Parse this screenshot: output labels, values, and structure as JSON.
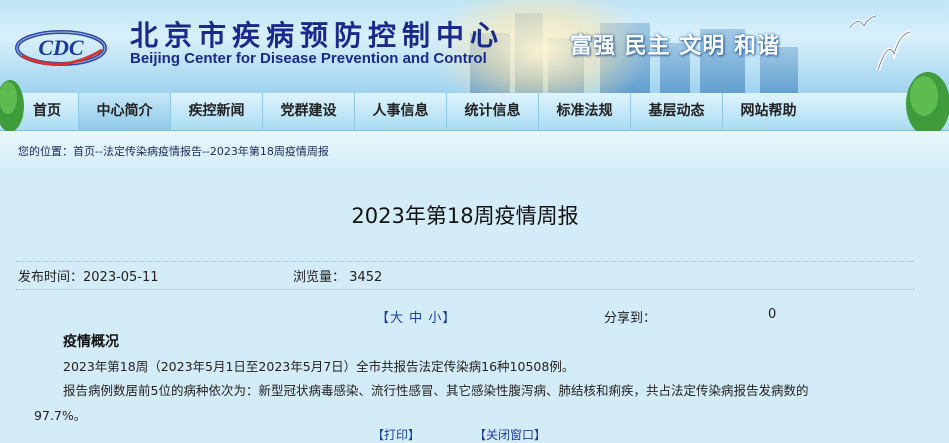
{
  "header": {
    "title_cn": "北京市疾病预防控制中心",
    "title_en": "Beijing Center for Disease Prevention and Control",
    "logo_text": "CDC",
    "slogan": "富强 民主 文明 和谐"
  },
  "nav": {
    "items": [
      {
        "label": "首页"
      },
      {
        "label": "中心简介"
      },
      {
        "label": "疾控新闻"
      },
      {
        "label": "党群建设"
      },
      {
        "label": "人事信息"
      },
      {
        "label": "统计信息"
      },
      {
        "label": "标准法规"
      },
      {
        "label": "基层动态"
      },
      {
        "label": "网站帮助"
      }
    ],
    "active_index": 1
  },
  "breadcrumb": {
    "prefix": "您的位置：",
    "home": "首页",
    "sep1": "--",
    "section": "法定传染病疫情报告",
    "sep2": "--",
    "current": "2023年第18周疫情周报"
  },
  "article": {
    "title": "2023年第18周疫情周报",
    "publish_label": "发布时间：",
    "publish_date": "2023-05-11",
    "views_label": "浏览量：",
    "views": "3452",
    "font_open": "【",
    "font_large": "大",
    "font_medium": "中",
    "font_small": "小",
    "font_close": "】",
    "share_label": "分享到：",
    "share_count": "0",
    "section_heading": "疫情概况",
    "para1": "2023年第18周（2023年5月1日至2023年5月7日）全市共报告法定传染病16种10508例。",
    "para2": "报告病例数居前5位的病种依次为：新型冠状病毒感染、流行性感冒、其它感染性腹泻病、肺结核和痢疾，共占法定传染病报告发病数的",
    "para3": "97.7%。",
    "print_label": "【打印】",
    "close_label": "【关闭窗口】"
  },
  "colors": {
    "nav_text": "#222222",
    "title_blue": "#1b2a8a",
    "link_blue": "#1b3fa0",
    "page_bg": "#d4ecf7"
  }
}
